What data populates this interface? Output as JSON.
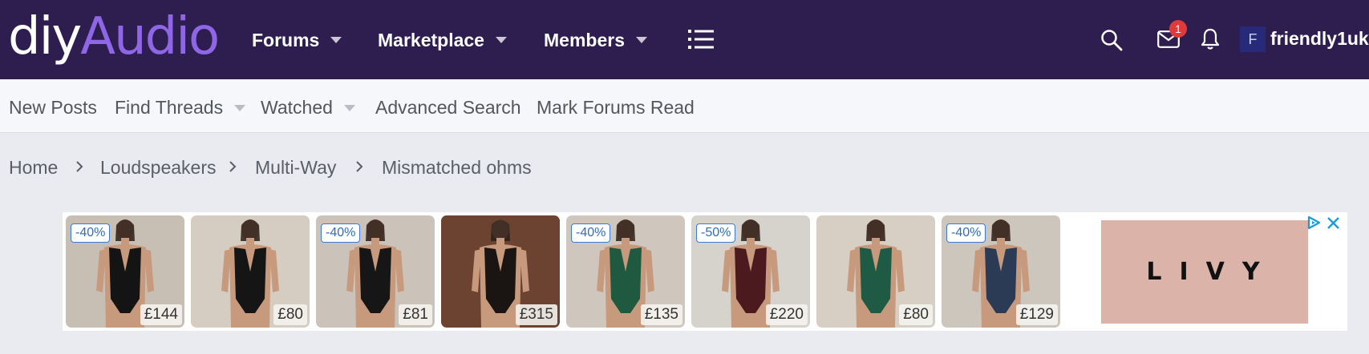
{
  "logo": {
    "part1": "diy",
    "part2": "Audio"
  },
  "nav": {
    "forums": "Forums",
    "marketplace": "Marketplace",
    "members": "Members"
  },
  "user": {
    "avatar_letter": "F",
    "name": "friendly1uk",
    "inbox_count": "1"
  },
  "subnav": {
    "new_posts": "New Posts",
    "find_threads": "Find Threads",
    "watched": "Watched",
    "advanced_search": "Advanced Search",
    "mark_read": "Mark Forums Read"
  },
  "breadcrumb": [
    "Home",
    "Loudspeakers",
    "Multi-Way",
    "Mismatched ohms"
  ],
  "ad": {
    "brand": "LIVY",
    "products": [
      {
        "discount": "-40%",
        "price": "£144",
        "bg": "#c8bfb4",
        "suit": "#141414"
      },
      {
        "discount": "",
        "price": "£80",
        "bg": "#d5ccc2",
        "suit": "#151515"
      },
      {
        "discount": "-40%",
        "price": "£81",
        "bg": "#cbc3b9",
        "suit": "#161616"
      },
      {
        "discount": "",
        "price": "£315",
        "bg": "#6b4330",
        "suit": "#1a1512"
      },
      {
        "discount": "-40%",
        "price": "£135",
        "bg": "#cfc7bd",
        "suit": "#1f5a40"
      },
      {
        "discount": "-50%",
        "price": "£220",
        "bg": "#d6d2cc",
        "suit": "#4a1a1f"
      },
      {
        "discount": "",
        "price": "£80",
        "bg": "#d8cfc4",
        "suit": "#1e5a44"
      },
      {
        "discount": "-40%",
        "price": "£129",
        "bg": "#cdc6bd",
        "suit": "#2b3a55"
      }
    ]
  },
  "colors": {
    "topbar": "#2e1e50",
    "logo_accent": "#8f67e6",
    "badge": "#e03b3b"
  }
}
